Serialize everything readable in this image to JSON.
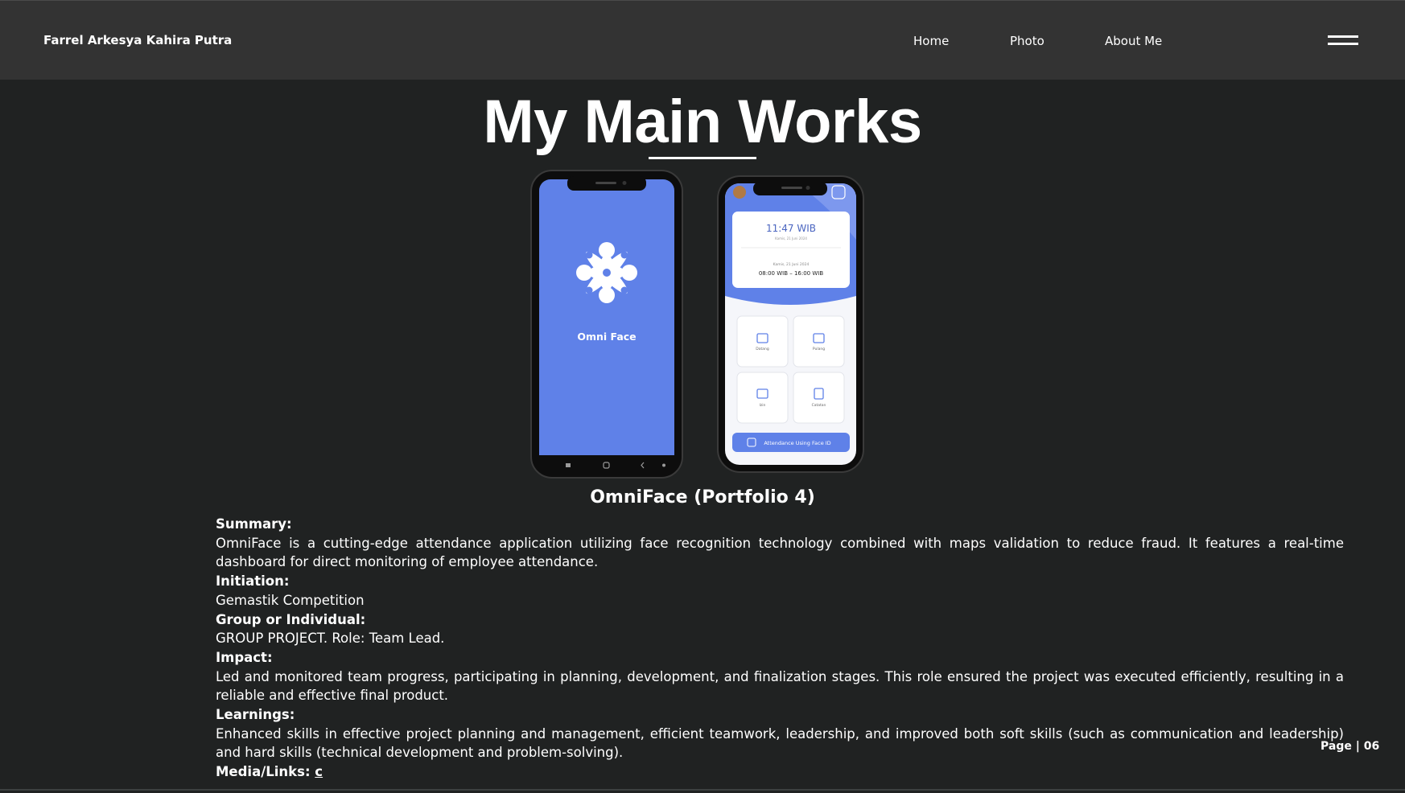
{
  "header": {
    "brand": "Farrel Arkesya Kahira Putra",
    "nav": [
      "Home",
      "Photo",
      "About Me"
    ],
    "menu_icon": "hamburger-icon"
  },
  "main": {
    "title": "My Main Works",
    "project_title": "OmniFace (Portfolio 4)"
  },
  "mockups": {
    "splash": {
      "app_name": "Omni Face",
      "bg_color": "#5f81e8"
    },
    "home": {
      "time": "11:47 WIB",
      "date_small": "Kamis, 21 Juni 2024",
      "date": "Kamis, 21 Juni 2024",
      "shift": "08:00 WIB – 16:00 WIB",
      "menu": [
        "Datang",
        "Pulang",
        "Izin",
        "Catatan"
      ],
      "cta": "Attendance Using Face ID"
    }
  },
  "details": {
    "summary_label": "Summary:",
    "summary": "OmniFace is a cutting-edge attendance application utilizing face recognition technology combined with maps validation to reduce fraud. It features a real-time dashboard for direct monitoring of employee attendance.",
    "initiation_label": "Initiation:",
    "initiation": "Gemastik Competition",
    "group_label": "Group or Individual:",
    "group": "GROUP PROJECT. Role: Team Lead.",
    "impact_label": "Impact:",
    "impact": "Led and monitored team progress, participating in planning, development, and finalization stages. This role ensured the project was executed efficiently, resulting in a reliable and effective final product.",
    "learnings_label": "Learnings:",
    "learnings": "Enhanced skills in effective project planning and management, efficient teamwork, leadership, and improved both soft skills (such as communication and leadership) and hard skills (technical development and problem-solving).",
    "media_label": "Media/Links:",
    "media_link": "c"
  },
  "footer": {
    "page": "Page | 06"
  }
}
